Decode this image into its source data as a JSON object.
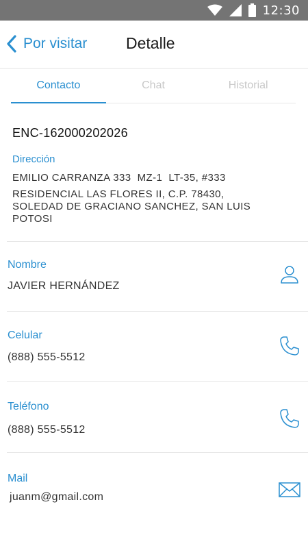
{
  "status_bar": {
    "time": "12:30"
  },
  "header": {
    "back_label": "Por visitar",
    "title": "Detalle"
  },
  "tabs": [
    {
      "label": "Contacto",
      "active": true
    },
    {
      "label": "Chat",
      "active": false
    },
    {
      "label": "Historial",
      "active": false
    }
  ],
  "contact": {
    "code": "ENC-162000202026",
    "address_label": "Dirección",
    "address_line1": "EMILIO CARRANZA 333  MZ-1  LT-35, #333",
    "address_line2": "RESIDENCIAL LAS FLORES II, C.P. 78430, SOLEDAD DE GRACIANO SANCHEZ, SAN LUIS POTOSI",
    "name_label": "Nombre",
    "name_value": "JAVIER HERNÁNDEZ",
    "mobile_label": "Celular",
    "mobile_value": "(888) 555-5512",
    "phone_label": "Teléfono",
    "phone_value": "(888) 555-5512",
    "mail_label": "Mail",
    "mail_value": "juanm@gmail.com"
  },
  "colors": {
    "accent": "#2a8fd0",
    "status_bar": "#747474",
    "divider": "#e6e6e6"
  },
  "icons": {
    "back": "chevron-left-icon",
    "name": "person-icon",
    "mobile": "phone-icon",
    "phone": "phone-icon",
    "mail": "envelope-icon"
  }
}
